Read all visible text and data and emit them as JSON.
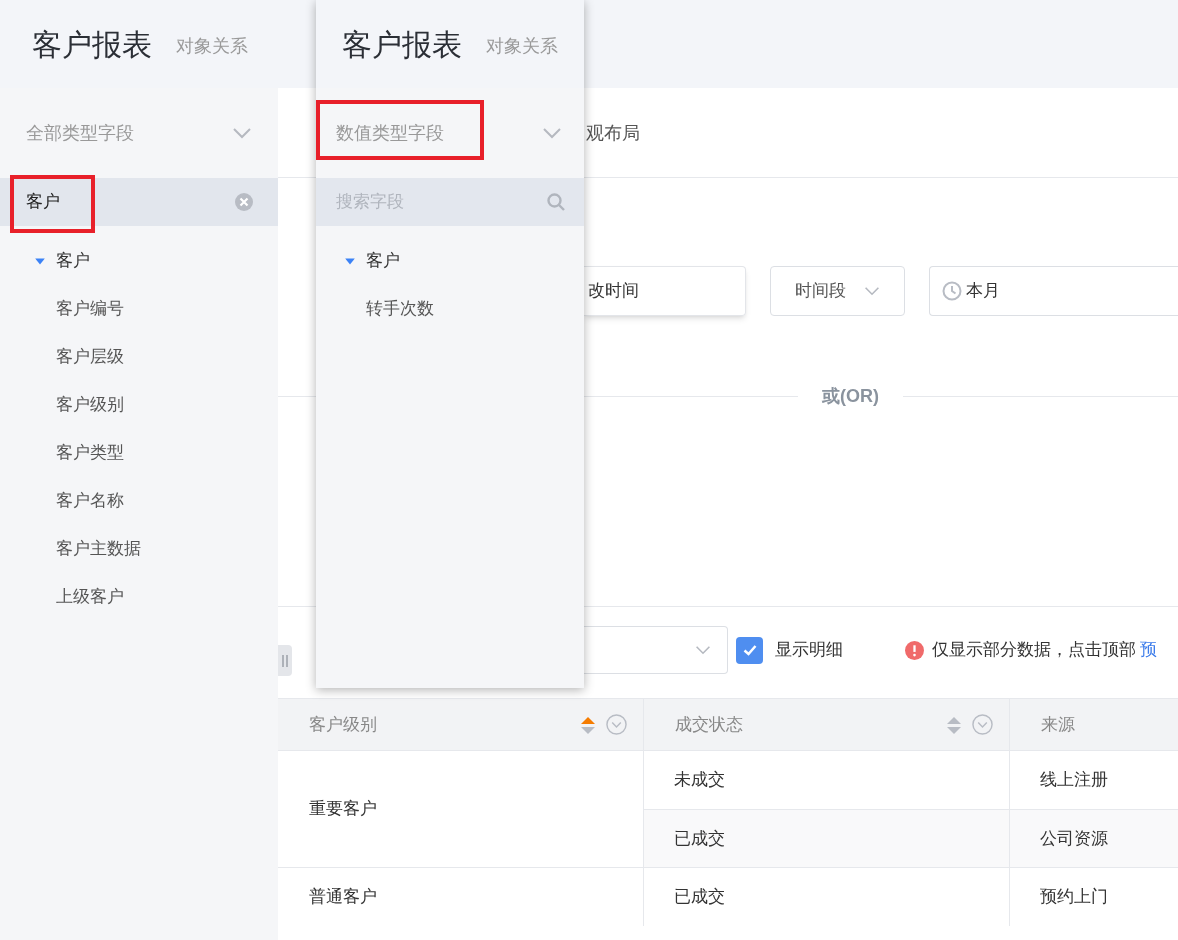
{
  "header": {
    "title": "客户报表",
    "subtitle": "对象关系"
  },
  "sidebar": {
    "type_select": {
      "label": "全部类型字段"
    },
    "search": {
      "value": "客户",
      "highlighted": true
    },
    "tree": [
      {
        "label": "客户",
        "expanded": true,
        "children": [
          {
            "label": "客户编号"
          },
          {
            "label": "客户层级"
          },
          {
            "label": "客户级别"
          },
          {
            "label": "客户类型"
          },
          {
            "label": "客户名称"
          },
          {
            "label": "客户主数据"
          },
          {
            "label": "上级客户"
          }
        ]
      }
    ]
  },
  "popup": {
    "title": "客户报表",
    "subtitle": "对象关系",
    "type_select": {
      "label": "数值类型字段",
      "highlighted": true
    },
    "search": {
      "placeholder": "搜索字段"
    },
    "tree": [
      {
        "label": "客户",
        "expanded": true,
        "children": [
          {
            "label": "转手次数"
          }
        ]
      }
    ]
  },
  "main": {
    "tab_label": "观布局",
    "filter": {
      "field": "改时间",
      "period": "时间段",
      "range": "本月"
    },
    "divider": "或(OR)",
    "toolbar": {
      "show_detail": {
        "label": "显示明细",
        "checked": true
      },
      "notice": {
        "text": "仅显示部分数据，点击顶部",
        "link": "预"
      }
    },
    "table": {
      "columns": [
        {
          "label": "客户级别",
          "sorted": true
        },
        {
          "label": "成交状态",
          "sorted": false
        },
        {
          "label": "来源"
        }
      ],
      "groups": [
        {
          "level": "重要客户",
          "items": [
            {
              "status": "未成交",
              "source": "线上注册"
            },
            {
              "status": "已成交",
              "source": "公司资源"
            }
          ]
        },
        {
          "level": "普通客户",
          "items": [
            {
              "status": "已成交",
              "source": "预约上门"
            }
          ]
        }
      ]
    }
  }
}
